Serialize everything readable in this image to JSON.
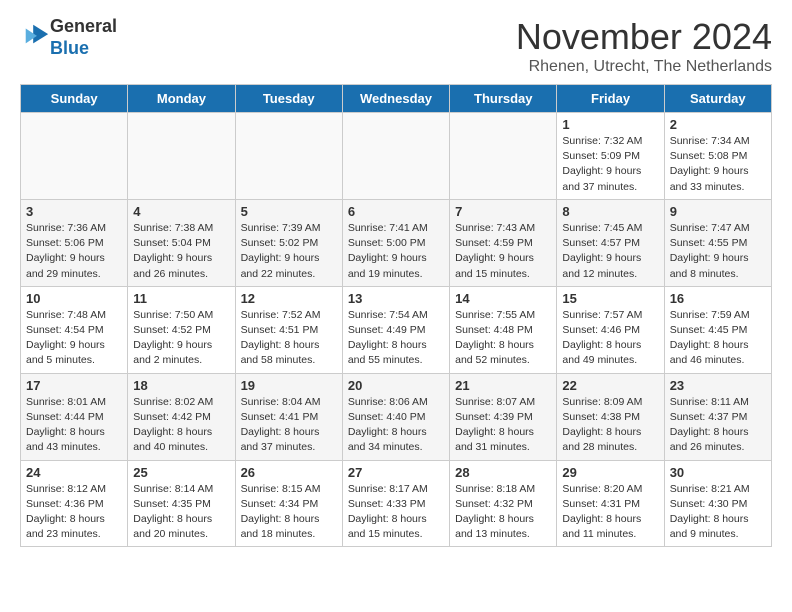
{
  "header": {
    "logo_line1": "General",
    "logo_line2": "Blue",
    "month_title": "November 2024",
    "subtitle": "Rhenen, Utrecht, The Netherlands"
  },
  "days_of_week": [
    "Sunday",
    "Monday",
    "Tuesday",
    "Wednesday",
    "Thursday",
    "Friday",
    "Saturday"
  ],
  "weeks": [
    [
      {
        "day": "",
        "info": ""
      },
      {
        "day": "",
        "info": ""
      },
      {
        "day": "",
        "info": ""
      },
      {
        "day": "",
        "info": ""
      },
      {
        "day": "",
        "info": ""
      },
      {
        "day": "1",
        "info": "Sunrise: 7:32 AM\nSunset: 5:09 PM\nDaylight: 9 hours and 37 minutes."
      },
      {
        "day": "2",
        "info": "Sunrise: 7:34 AM\nSunset: 5:08 PM\nDaylight: 9 hours and 33 minutes."
      }
    ],
    [
      {
        "day": "3",
        "info": "Sunrise: 7:36 AM\nSunset: 5:06 PM\nDaylight: 9 hours and 29 minutes."
      },
      {
        "day": "4",
        "info": "Sunrise: 7:38 AM\nSunset: 5:04 PM\nDaylight: 9 hours and 26 minutes."
      },
      {
        "day": "5",
        "info": "Sunrise: 7:39 AM\nSunset: 5:02 PM\nDaylight: 9 hours and 22 minutes."
      },
      {
        "day": "6",
        "info": "Sunrise: 7:41 AM\nSunset: 5:00 PM\nDaylight: 9 hours and 19 minutes."
      },
      {
        "day": "7",
        "info": "Sunrise: 7:43 AM\nSunset: 4:59 PM\nDaylight: 9 hours and 15 minutes."
      },
      {
        "day": "8",
        "info": "Sunrise: 7:45 AM\nSunset: 4:57 PM\nDaylight: 9 hours and 12 minutes."
      },
      {
        "day": "9",
        "info": "Sunrise: 7:47 AM\nSunset: 4:55 PM\nDaylight: 9 hours and 8 minutes."
      }
    ],
    [
      {
        "day": "10",
        "info": "Sunrise: 7:48 AM\nSunset: 4:54 PM\nDaylight: 9 hours and 5 minutes."
      },
      {
        "day": "11",
        "info": "Sunrise: 7:50 AM\nSunset: 4:52 PM\nDaylight: 9 hours and 2 minutes."
      },
      {
        "day": "12",
        "info": "Sunrise: 7:52 AM\nSunset: 4:51 PM\nDaylight: 8 hours and 58 minutes."
      },
      {
        "day": "13",
        "info": "Sunrise: 7:54 AM\nSunset: 4:49 PM\nDaylight: 8 hours and 55 minutes."
      },
      {
        "day": "14",
        "info": "Sunrise: 7:55 AM\nSunset: 4:48 PM\nDaylight: 8 hours and 52 minutes."
      },
      {
        "day": "15",
        "info": "Sunrise: 7:57 AM\nSunset: 4:46 PM\nDaylight: 8 hours and 49 minutes."
      },
      {
        "day": "16",
        "info": "Sunrise: 7:59 AM\nSunset: 4:45 PM\nDaylight: 8 hours and 46 minutes."
      }
    ],
    [
      {
        "day": "17",
        "info": "Sunrise: 8:01 AM\nSunset: 4:44 PM\nDaylight: 8 hours and 43 minutes."
      },
      {
        "day": "18",
        "info": "Sunrise: 8:02 AM\nSunset: 4:42 PM\nDaylight: 8 hours and 40 minutes."
      },
      {
        "day": "19",
        "info": "Sunrise: 8:04 AM\nSunset: 4:41 PM\nDaylight: 8 hours and 37 minutes."
      },
      {
        "day": "20",
        "info": "Sunrise: 8:06 AM\nSunset: 4:40 PM\nDaylight: 8 hours and 34 minutes."
      },
      {
        "day": "21",
        "info": "Sunrise: 8:07 AM\nSunset: 4:39 PM\nDaylight: 8 hours and 31 minutes."
      },
      {
        "day": "22",
        "info": "Sunrise: 8:09 AM\nSunset: 4:38 PM\nDaylight: 8 hours and 28 minutes."
      },
      {
        "day": "23",
        "info": "Sunrise: 8:11 AM\nSunset: 4:37 PM\nDaylight: 8 hours and 26 minutes."
      }
    ],
    [
      {
        "day": "24",
        "info": "Sunrise: 8:12 AM\nSunset: 4:36 PM\nDaylight: 8 hours and 23 minutes."
      },
      {
        "day": "25",
        "info": "Sunrise: 8:14 AM\nSunset: 4:35 PM\nDaylight: 8 hours and 20 minutes."
      },
      {
        "day": "26",
        "info": "Sunrise: 8:15 AM\nSunset: 4:34 PM\nDaylight: 8 hours and 18 minutes."
      },
      {
        "day": "27",
        "info": "Sunrise: 8:17 AM\nSunset: 4:33 PM\nDaylight: 8 hours and 15 minutes."
      },
      {
        "day": "28",
        "info": "Sunrise: 8:18 AM\nSunset: 4:32 PM\nDaylight: 8 hours and 13 minutes."
      },
      {
        "day": "29",
        "info": "Sunrise: 8:20 AM\nSunset: 4:31 PM\nDaylight: 8 hours and 11 minutes."
      },
      {
        "day": "30",
        "info": "Sunrise: 8:21 AM\nSunset: 4:30 PM\nDaylight: 8 hours and 9 minutes."
      }
    ]
  ]
}
